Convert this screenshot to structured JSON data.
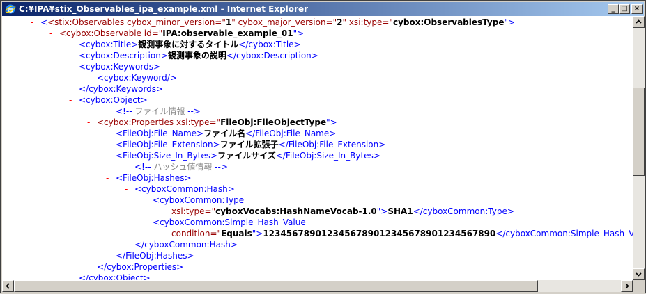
{
  "window": {
    "title": "C:¥IPA¥stix_Observables_ipa_example.xml - Internet Explorer",
    "buttons": {
      "minimize": "_",
      "maximize": "□",
      "close": "×"
    }
  },
  "xml": {
    "observables_open": {
      "marker": "-",
      "tag": "<stix:Observables",
      "attr1": " cybox_minor_version=\"",
      "val1": "1",
      "attr2": "\" cybox_major_version=\"",
      "val2": "2",
      "attr3": "\" xsi:type=\"",
      "val3": "cybox:ObservablesType",
      "end": "\">"
    },
    "observable_open": {
      "marker": "-",
      "tag": "<cybox:Observable",
      "attr": " id=\"",
      "val": "IPA:observable_example_01",
      "end": "\">"
    },
    "title": {
      "open": "<cybox:Title>",
      "text": "観測事象に対するタイトル",
      "close": "</cybox:Title>"
    },
    "description": {
      "open": "<cybox:Description>",
      "text": "観測事象の説明",
      "close": "</cybox:Description>"
    },
    "keywords_open": {
      "marker": "-",
      "tag": "<cybox:Keywords>"
    },
    "keyword": {
      "tag": "<cybox:Keyword/>"
    },
    "keywords_close": {
      "tag": "</cybox:Keywords>"
    },
    "object_open": {
      "marker": "-",
      "tag": "<cybox:Object>"
    },
    "comment_file": {
      "open": "<!--",
      "text": " ファイル情報 ",
      "close": "-->"
    },
    "properties_open": {
      "marker": "-",
      "tag": "<cybox:Properties",
      "attr": " xsi:type=\"",
      "val": "FileObj:FileObjectType",
      "end": "\">"
    },
    "file_name": {
      "open": "<FileObj:File_Name>",
      "text": "ファイル名",
      "close": "</FileObj:File_Name>"
    },
    "file_ext": {
      "open": "<FileObj:File_Extension>",
      "text": "ファイル拡張子",
      "close": "</FileObj:File_Extension>"
    },
    "file_size": {
      "open": "<FileObj:Size_In_Bytes>",
      "text": "ファイルサイズ",
      "close": "</FileObj:Size_In_Bytes>"
    },
    "comment_hash": {
      "open": "<!--",
      "text": " ハッシュ値情報 ",
      "close": "-->"
    },
    "hashes_open": {
      "marker": "-",
      "tag": "<FileObj:Hashes>"
    },
    "hash_open": {
      "marker": "-",
      "tag": "<cyboxCommon:Hash>"
    },
    "type_open": {
      "tag": "<cyboxCommon:Type"
    },
    "type_attr": {
      "attr": "xsi:type=\"",
      "val": "cyboxVocabs:HashNameVocab-1.0",
      "end": "\">",
      "text": "SHA1",
      "close": "</cyboxCommon:Type>"
    },
    "simple_open": {
      "tag": "<cyboxCommon:Simple_Hash_Value"
    },
    "simple_attr": {
      "attr": "condition=\"",
      "val": "Equals",
      "end": "\">",
      "text": "1234567890123456789012345678901234567890",
      "close": "</cyboxCommon:Simple_Hash_Value>"
    },
    "hash_close": {
      "tag": "</cyboxCommon:Hash>"
    },
    "hashes_close": {
      "tag": "</FileObj:Hashes>"
    },
    "properties_close": {
      "tag": "</cybox:Properties>"
    },
    "object_close": {
      "tag": "</cybox:Object>"
    }
  },
  "scroll": {
    "vertical_thumb": "",
    "horizontal_thumb": ""
  }
}
